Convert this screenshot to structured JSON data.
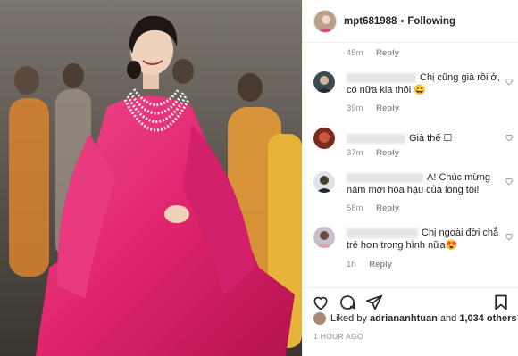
{
  "post": {
    "username": "mpt681988",
    "separator": "•",
    "follow_status": "Following"
  },
  "top_meta": {
    "time": "45m",
    "reply": "Reply"
  },
  "comments": [
    {
      "text": "Chị cũng già rồi ở, có nữa kia thôi 😄",
      "time": "39m",
      "reply": "Reply"
    },
    {
      "text": "Già thế ☐",
      "time": "37m",
      "reply": "Reply"
    },
    {
      "text": "Ạ! Chúc mừng năm mới hoa hậu của lòng tôi!",
      "time": "58m",
      "reply": "Reply"
    },
    {
      "text": "Chị ngoài đời chẳ trẻ hơn trong hình nữa😍",
      "time": "1h",
      "reply": "Reply"
    }
  ],
  "likes": {
    "prefix": "Liked by",
    "user": "adriananhtuan",
    "joiner": "and",
    "count": "1,034 others"
  },
  "timestamp": "1 HOUR AGO",
  "icons": [
    "heart-icon",
    "comment-icon",
    "share-icon",
    "bookmark-icon"
  ]
}
